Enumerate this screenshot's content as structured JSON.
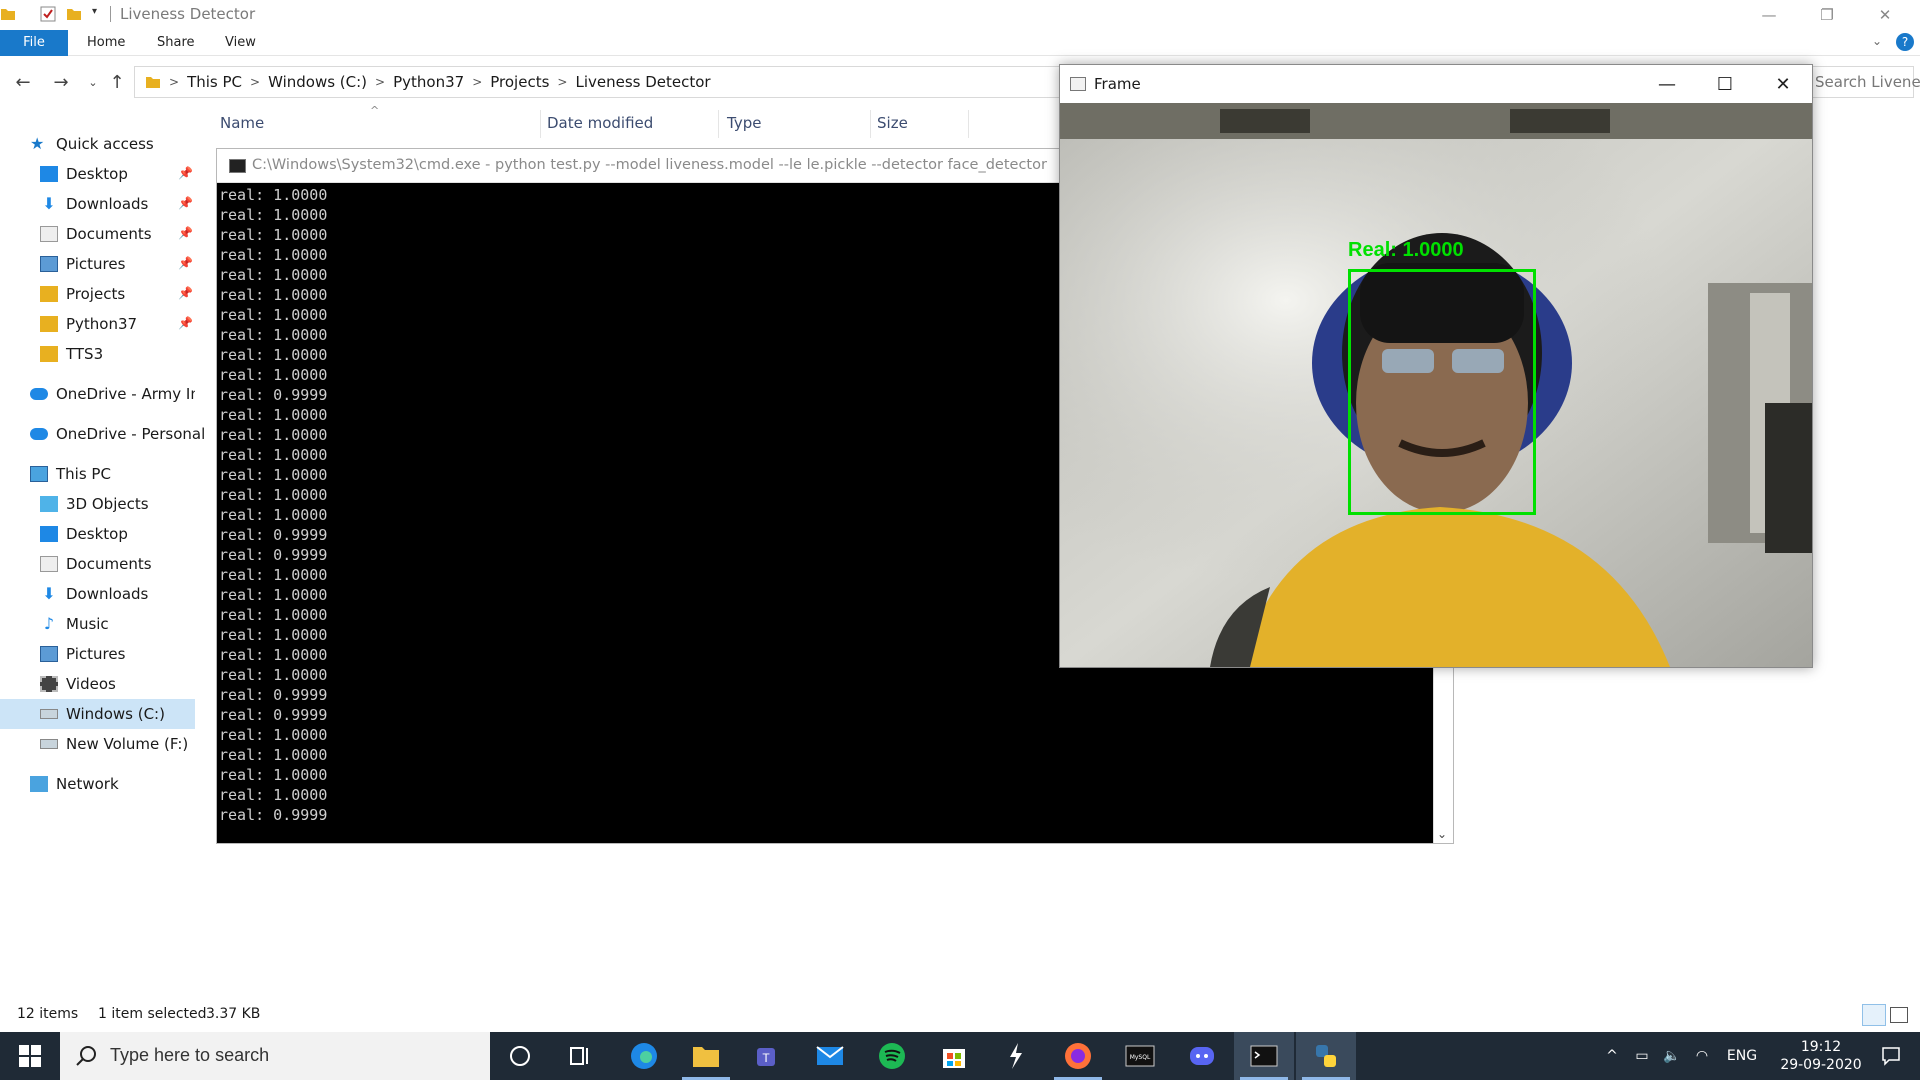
{
  "window": {
    "title": "Liveness Detector",
    "ribbon_tabs": [
      "File",
      "Home",
      "Share",
      "View"
    ]
  },
  "breadcrumb": [
    "This PC",
    "Windows (C:)",
    "Python37",
    "Projects",
    "Liveness Detector"
  ],
  "search_placeholder": "Search Liveness De...",
  "sidebar": {
    "quick_access": "Quick access",
    "pinned": [
      "Desktop",
      "Downloads",
      "Documents",
      "Pictures",
      "Projects",
      "Python37"
    ],
    "unpinned": [
      "TTS3"
    ],
    "onedrive_army": "OneDrive - Army Insti",
    "onedrive_personal": "OneDrive - Personal",
    "this_pc": "This PC",
    "this_pc_items": [
      "3D Objects",
      "Desktop",
      "Documents",
      "Downloads",
      "Music",
      "Pictures",
      "Videos",
      "Windows (C:)",
      "New Volume (F:)"
    ],
    "network": "Network"
  },
  "columns": {
    "name": "Name",
    "date_modified": "Date modified",
    "type": "Type",
    "size": "Size"
  },
  "cmd": {
    "title": "C:\\Windows\\System32\\cmd.exe - python  test.py --model liveness.model --le le.pickle --detector face_detector",
    "lines": [
      "real: 1.0000",
      "real: 1.0000",
      "real: 1.0000",
      "real: 1.0000",
      "real: 1.0000",
      "real: 1.0000",
      "real: 1.0000",
      "real: 1.0000",
      "real: 1.0000",
      "real: 1.0000",
      "real: 0.9999",
      "real: 1.0000",
      "real: 1.0000",
      "real: 1.0000",
      "real: 1.0000",
      "real: 1.0000",
      "real: 1.0000",
      "real: 0.9999",
      "real: 0.9999",
      "real: 1.0000",
      "real: 1.0000",
      "real: 1.0000",
      "real: 1.0000",
      "real: 1.0000",
      "real: 1.0000",
      "real: 0.9999",
      "real: 0.9999",
      "real: 1.0000",
      "real: 1.0000",
      "real: 1.0000",
      "real: 1.0000",
      "real: 0.9999"
    ]
  },
  "frame": {
    "title": "Frame",
    "label": "Real:  1.0000",
    "box_color": "#00e000"
  },
  "status": {
    "items": "12 items",
    "selected": "1 item selected",
    "size": "3.37 KB"
  },
  "taskbar": {
    "search_placeholder": "Type here to search",
    "language": "ENG",
    "time": "19:12",
    "date": "29-09-2020",
    "apps": [
      "cortana-icon",
      "task-view-icon",
      "edge-icon",
      "file-explorer-icon",
      "teams-icon",
      "mail-icon",
      "spotify-icon",
      "store-icon",
      "sublime-icon",
      "firefox-icon",
      "mysql-icon",
      "discord-icon",
      "terminal-icon",
      "python-icon"
    ]
  },
  "colors": {
    "accent": "#1979ca",
    "taskbar": "#1f2a36",
    "console_bg": "#000000",
    "console_fg": "#cfcfcf"
  }
}
